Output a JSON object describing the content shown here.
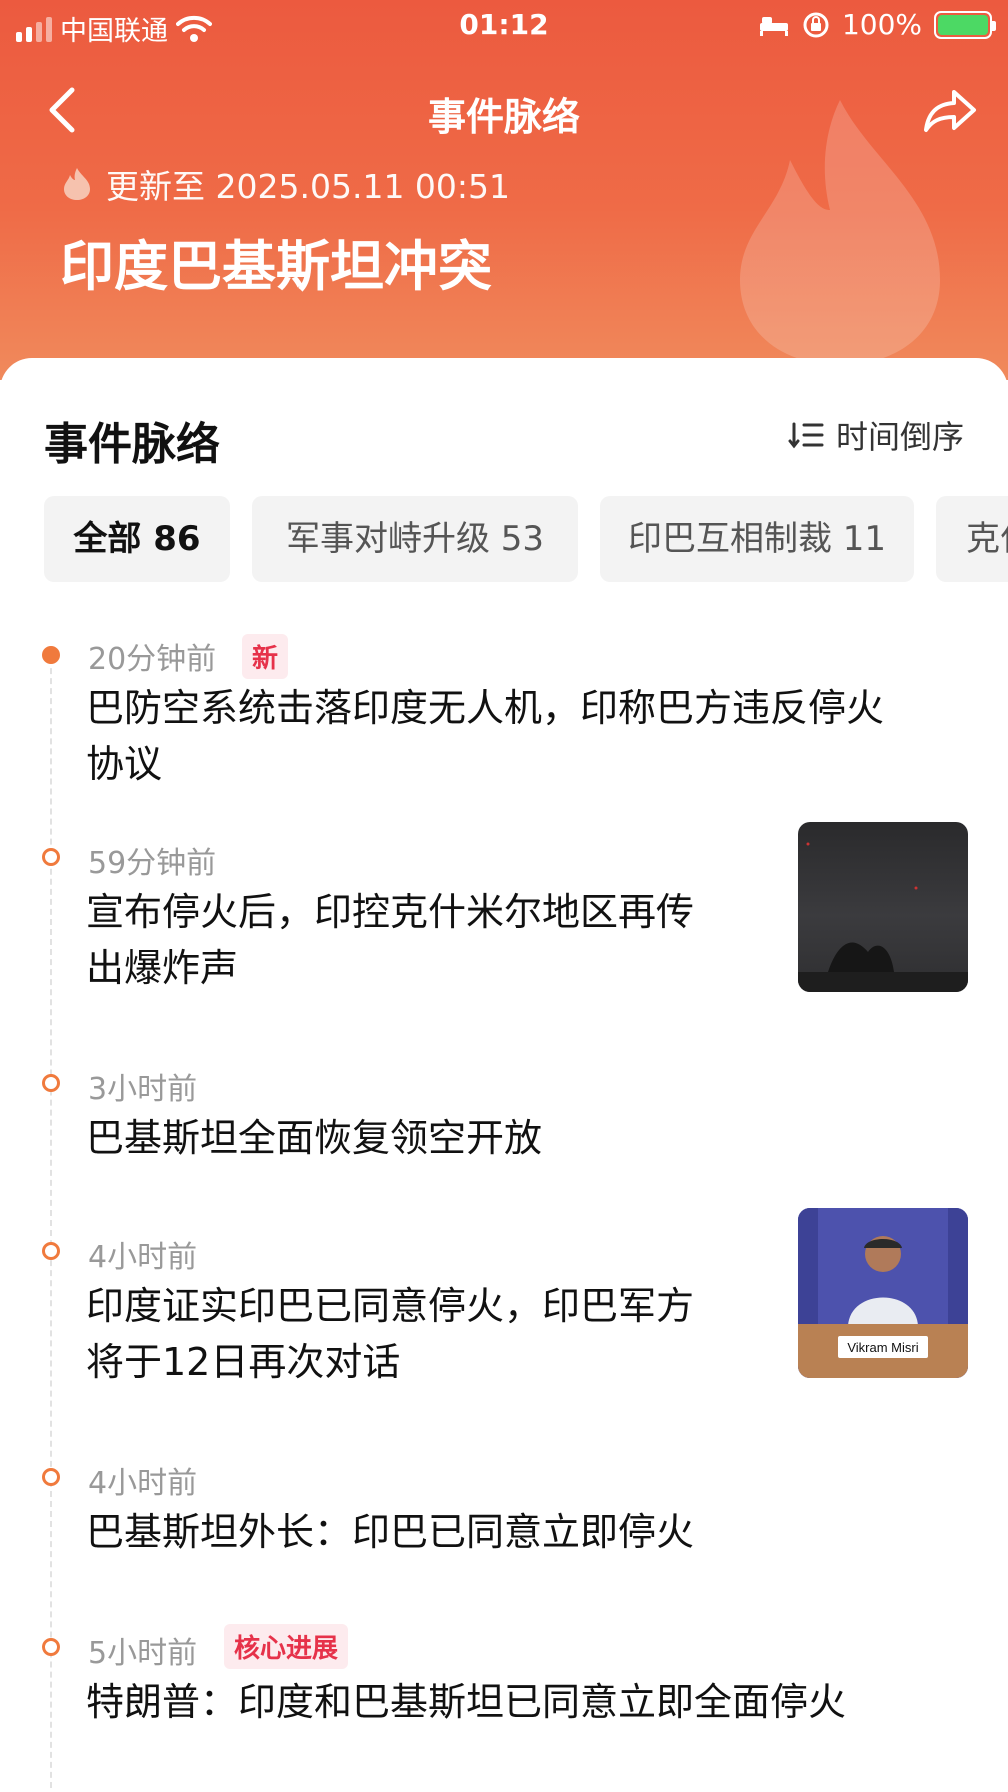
{
  "status_bar": {
    "carrier": "中国联通",
    "time": "01:12",
    "battery": "100%"
  },
  "nav": {
    "title": "事件脉络",
    "back_icon": "chevron-left-icon",
    "share_icon": "share-arrow-icon"
  },
  "header": {
    "update_text": "更新至 2025.05.11 00:51",
    "topic_title": "印度巴基斯坦冲突"
  },
  "section": {
    "title": "事件脉络",
    "sort_label": "时间倒序"
  },
  "tabs": [
    {
      "label": "全部 86",
      "active": true
    },
    {
      "label": "军事对峙升级 53",
      "active": false
    },
    {
      "label": "印巴互相制裁 11",
      "active": false
    },
    {
      "label": "克什",
      "active": false
    }
  ],
  "events": [
    {
      "time": "20分钟前",
      "badge": "新",
      "headline_line1": "巴防空系统击落印度无人机，印称巴方违反停火",
      "headline_line2": "协议"
    },
    {
      "time": "59分钟前",
      "badge": "",
      "headline_line1": "宣布停火后，印控克什米尔地区再传",
      "headline_line2": "出爆炸声"
    },
    {
      "time": "3小时前",
      "badge": "",
      "headline_line1": "巴基斯坦全面恢复领空开放",
      "headline_line2": ""
    },
    {
      "time": "4小时前",
      "badge": "",
      "headline_line1": "印度证实印巴已同意停火，印巴军方",
      "headline_line2": "将于12日再次对话",
      "thumb_caption": "Vikram Misri"
    },
    {
      "time": "4小时前",
      "badge": "",
      "headline_line1": "巴基斯坦外长：印巴已同意立即停火",
      "headline_line2": ""
    },
    {
      "time": "5小时前",
      "badge": "核心进展",
      "headline_line1": "特朗普：印度和巴基斯坦已同意立即全面停火",
      "headline_line2": ""
    }
  ],
  "colors": {
    "header_top": "#ec5a3f",
    "accent_orange": "#f07a3d",
    "badge_red": "#e6324a"
  }
}
